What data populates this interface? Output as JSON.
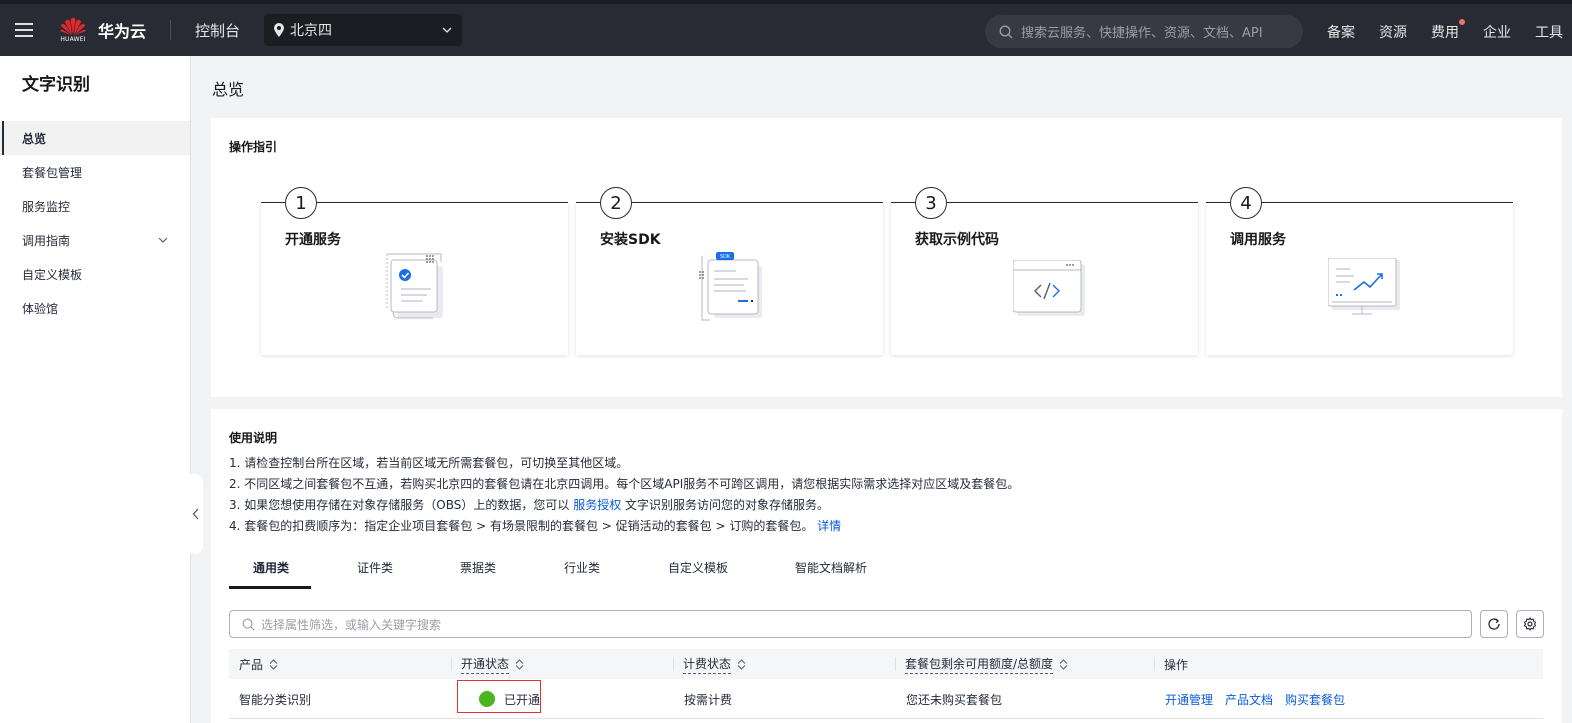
{
  "topbar": {
    "brand_logo_text": "HUAWEI",
    "brand": "华为云",
    "console": "控制台",
    "region": "北京四",
    "search_placeholder": "搜索云服务、快捷操作、资源、文档、API",
    "nav": [
      "备案",
      "资源",
      "费用",
      "企业",
      "工具"
    ]
  },
  "sidebar": {
    "title": "文字识别",
    "items": [
      "总览",
      "套餐包管理",
      "服务监控",
      "调用指南",
      "自定义模板",
      "体验馆"
    ]
  },
  "main": {
    "page_title": "总览",
    "guide": {
      "title": "操作指引",
      "steps": [
        {
          "num": "1",
          "title": "开通服务"
        },
        {
          "num": "2",
          "title": "安装SDK"
        },
        {
          "num": "3",
          "title": "获取示例代码"
        },
        {
          "num": "4",
          "title": "调用服务"
        }
      ],
      "sdk_badge": "SDK"
    },
    "usage": {
      "title": "使用说明",
      "note1": "1. 请检查控制台所在区域，若当前区域无所需套餐包，可切换至其他区域。",
      "note2": "2. 不同区域之间套餐包不互通，若购买北京四的套餐包请在北京四调用。每个区域API服务不可跨区调用，请您根据实际需求选择对应区域及套餐包。",
      "note3_pre": "3. 如果您想使用存储在对象存储服务（OBS）上的数据，您可以",
      "note3_link": "服务授权",
      "note3_post": "文字识别服务访问您的对象存储服务。",
      "note4_pre": "4. 套餐包的扣费顺序为：指定企业项目套餐包 > 有场景限制的套餐包 > 促销活动的套餐包 > 订购的套餐包。",
      "note4_link": "详情"
    },
    "tabs": [
      "通用类",
      "证件类",
      "票据类",
      "行业类",
      "自定义模板",
      "智能文档解析"
    ],
    "filter_placeholder": "选择属性筛选，或输入关键字搜索",
    "table": {
      "headers": [
        "产品",
        "开通状态",
        "计费状态",
        "套餐包剩余可用额度/总额度",
        "操作"
      ],
      "row": {
        "product": "智能分类识别",
        "status": "已开通",
        "billing": "按需计费",
        "quota": "您还未购买套餐包",
        "ops": [
          "开通管理",
          "产品文档",
          "购买套餐包"
        ]
      }
    }
  },
  "colors": {
    "accent": "#0b5cd5",
    "success": "#4ab51e",
    "highlight": "#e03333",
    "topbar": "#282b33"
  }
}
